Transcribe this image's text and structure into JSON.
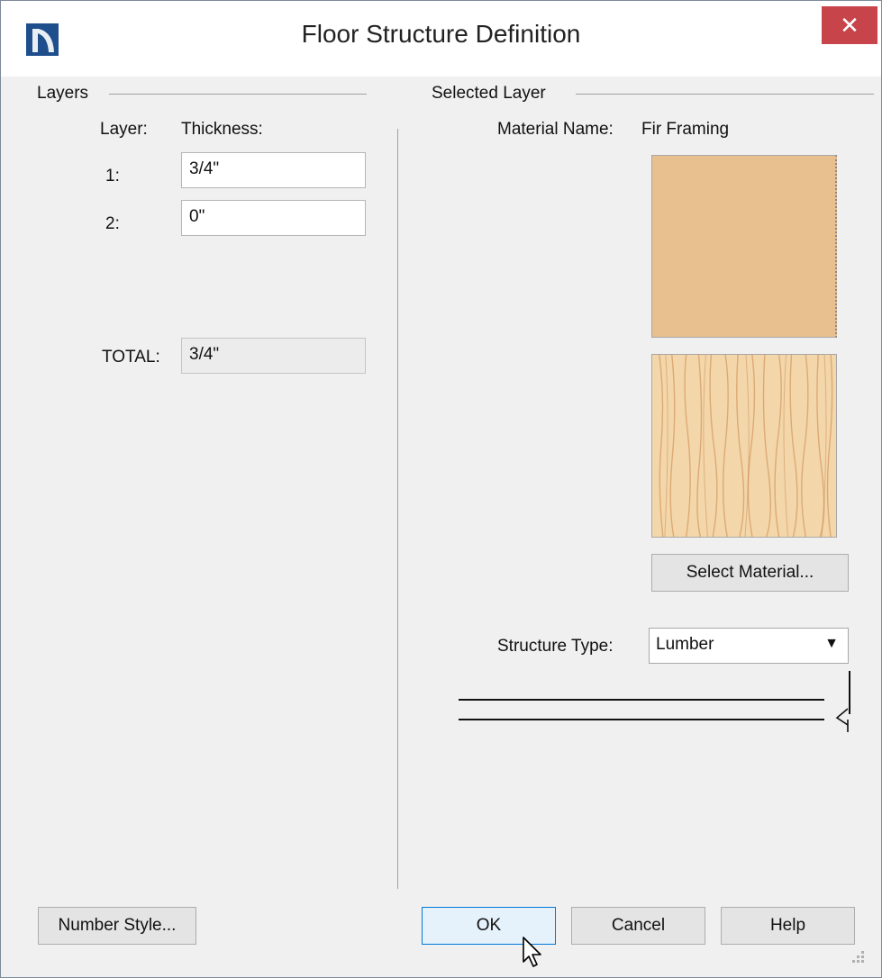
{
  "window": {
    "title": "Floor Structure Definition",
    "close_label": "✕"
  },
  "layers_group": {
    "label": "Layers",
    "col_layer": "Layer:",
    "col_thickness": "Thickness:",
    "rows": [
      {
        "index": "1:",
        "thickness": "3/4\""
      },
      {
        "index": "2:",
        "thickness": "0\""
      }
    ],
    "total_label": "TOTAL:",
    "total_value": "3/4\""
  },
  "selected_layer": {
    "label": "Selected Layer",
    "material_label": "Material Name:",
    "material_value": "Fir Framing",
    "select_material_button": "Select Material...",
    "structure_type_label": "Structure Type:",
    "structure_type_value": "Lumber"
  },
  "colors": {
    "swatch_color": "#e8c08f",
    "wood_base": "#f3d6a9",
    "wood_grain": "#d9a26b",
    "close_red": "#c7454a",
    "app_icon_blue": "#1f4e8c"
  },
  "buttons": {
    "number_style": "Number Style...",
    "ok": "OK",
    "cancel": "Cancel",
    "help": "Help"
  }
}
